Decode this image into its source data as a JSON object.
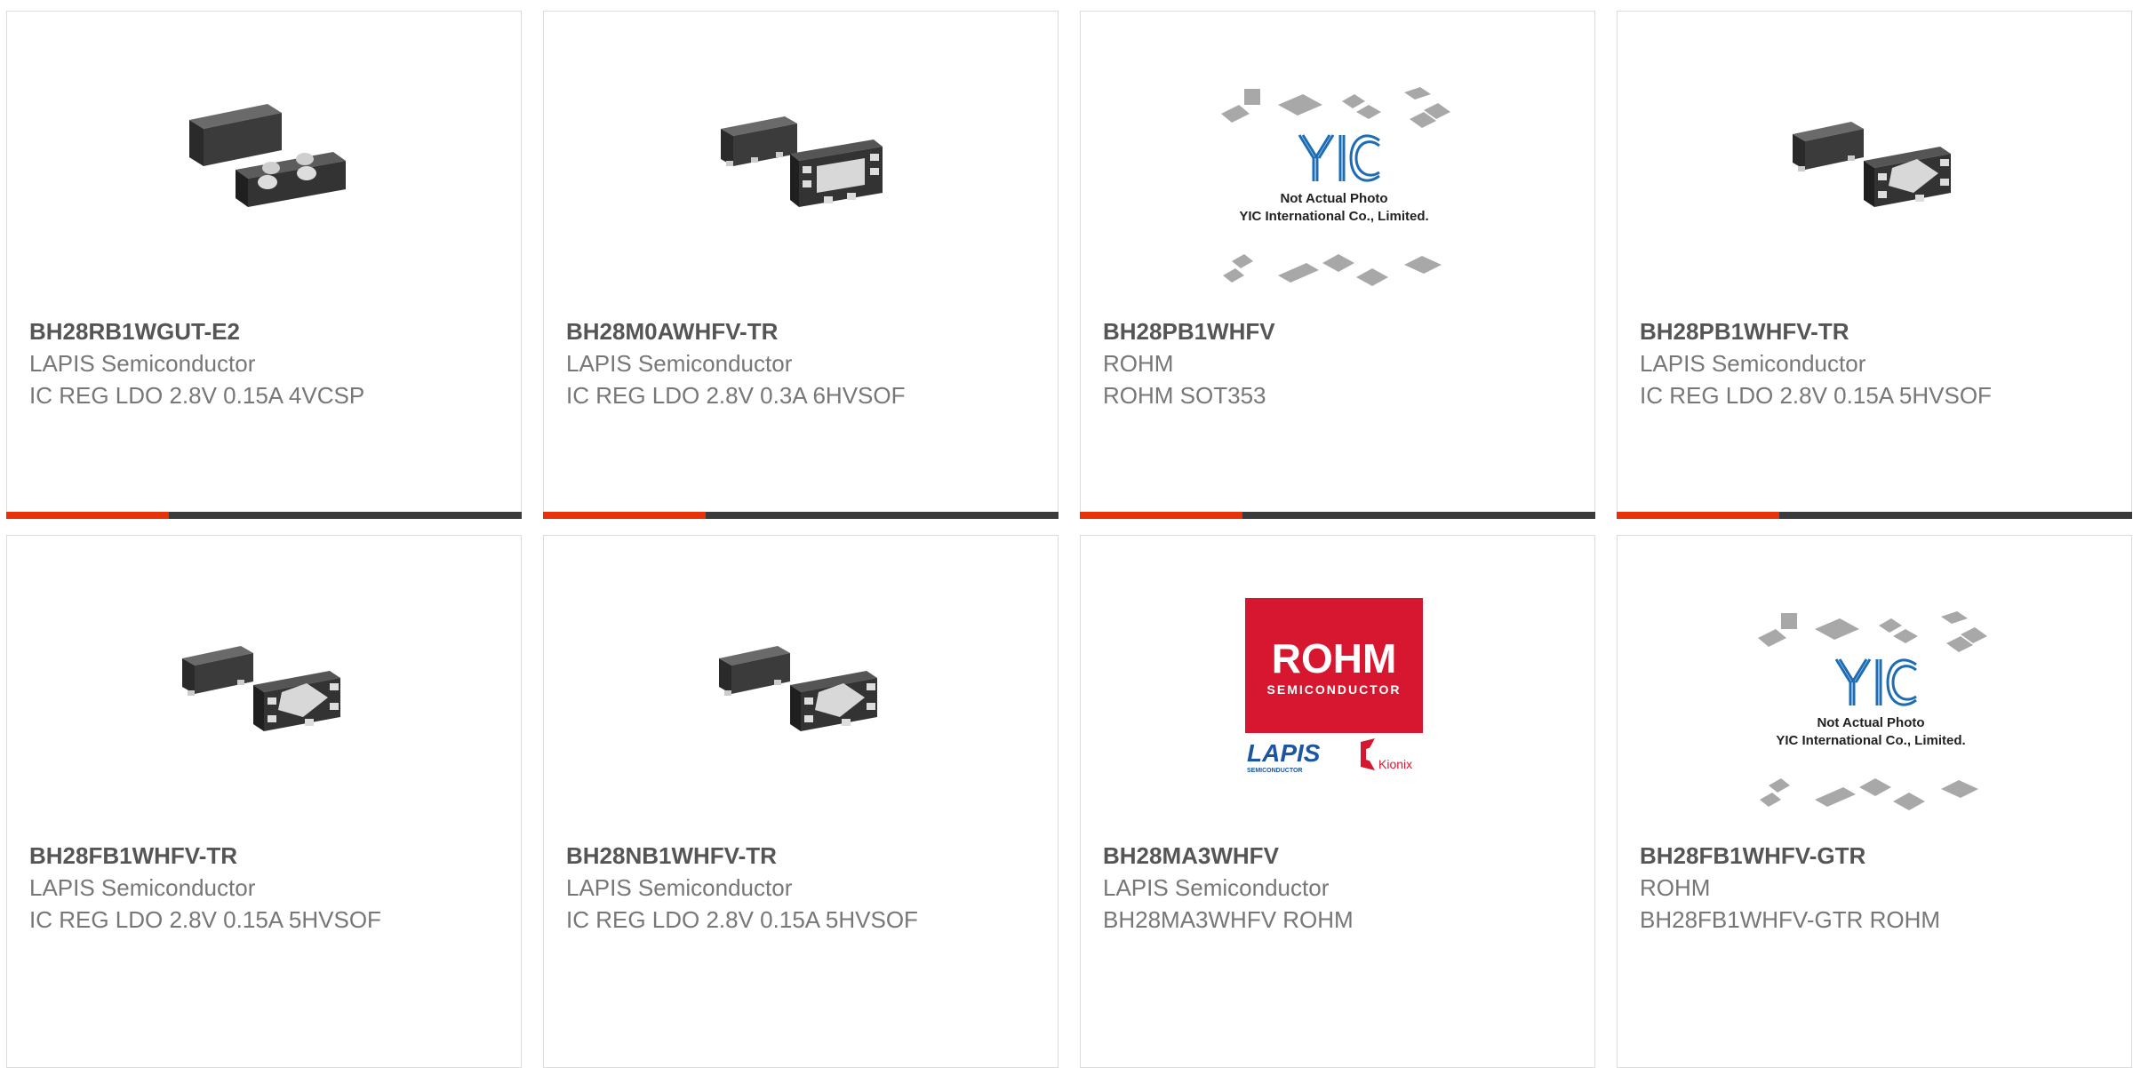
{
  "colors": {
    "accent": "#e8330a",
    "bar": "#3b3b3b",
    "title": "#555555",
    "text": "#777777"
  },
  "products": [
    {
      "part": "BH28RB1WGUT-E2",
      "mfr": "LAPIS Semiconductor",
      "desc": "IC REG LDO 2.8V 0.15A 4VCSP",
      "image": "chip-4vcsp"
    },
    {
      "part": "BH28M0AWHFV-TR",
      "mfr": "LAPIS Semiconductor",
      "desc": "IC REG LDO 2.8V 0.3A 6HVSOF",
      "image": "chip-6hvsof"
    },
    {
      "part": "BH28PB1WHFV",
      "mfr": "ROHM",
      "desc": "ROHM SOT353",
      "image": "yic-placeholder",
      "placeholder": {
        "logo": "YIC",
        "line1": "Not Actual Photo",
        "line2": "YIC International Co., Limited."
      }
    },
    {
      "part": "BH28PB1WHFV-TR",
      "mfr": "LAPIS Semiconductor",
      "desc": "IC REG LDO 2.8V 0.15A 5HVSOF",
      "image": "chip-5hvsof"
    },
    {
      "part": "BH28FB1WHFV-TR",
      "mfr": "LAPIS Semiconductor",
      "desc": "IC REG LDO 2.8V 0.15A 5HVSOF",
      "image": "chip-5hvsof"
    },
    {
      "part": "BH28NB1WHFV-TR",
      "mfr": "LAPIS Semiconductor",
      "desc": "IC REG LDO 2.8V 0.15A 5HVSOF",
      "image": "chip-5hvsof"
    },
    {
      "part": "BH28MA3WHFV",
      "mfr": "LAPIS Semiconductor",
      "desc": "BH28MA3WHFV ROHM",
      "image": "rohm-lapis-logo",
      "logo": {
        "brand": "ROHM",
        "brand_sub": "SEMICONDUCTOR",
        "lapis": "LAPIS",
        "lapis_sub": "SEMICONDUCTOR",
        "kionix": "Kionix"
      }
    },
    {
      "part": "BH28FB1WHFV-GTR",
      "mfr": "ROHM",
      "desc": "BH28FB1WHFV-GTR ROHM",
      "image": "yic-placeholder",
      "placeholder": {
        "logo": "YIC",
        "line1": "Not Actual Photo",
        "line2": "YIC International Co., Limited."
      }
    }
  ]
}
